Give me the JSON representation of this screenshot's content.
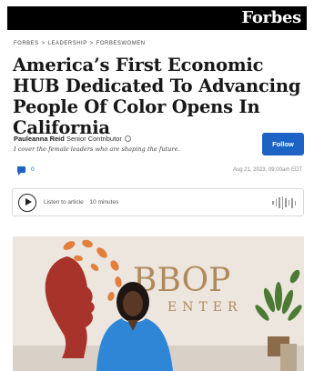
{
  "header": {
    "logo": "Forbes"
  },
  "breadcrumb": [
    "FORBES",
    ">",
    "LEADERSHIP",
    ">",
    "FORBESWOMEN"
  ],
  "article": {
    "headline": "America’s First Economic HUB Dedicated To Advancing People Of Color Opens In California",
    "author": "Pauleanna Reid",
    "author_role": "Senior Contributor",
    "author_tagline": "I cover the female leaders who are shaping the future.",
    "follow_label": "Follow",
    "comment_count": "0",
    "timestamp": "Aug 21, 2023, 09:00am EDT"
  },
  "audio": {
    "label": "Listen to article",
    "duration": "10 minutes"
  },
  "photo": {
    "sign_text": "BBOP",
    "sign_subtext": "ENTER"
  },
  "colors": {
    "accent": "#1d63c5",
    "topbar": "#000000"
  },
  "icons": [
    "verified-icon",
    "comment-icon",
    "play-icon",
    "audio-wave-icon"
  ]
}
